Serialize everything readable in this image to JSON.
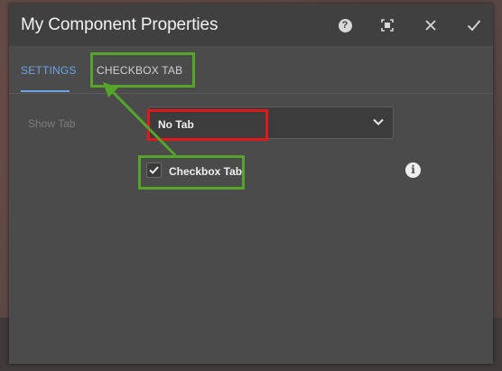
{
  "dialog": {
    "title": "My Component Properties",
    "header_icons": [
      "help-icon",
      "fullscreen-icon",
      "close-icon",
      "check-icon"
    ],
    "help_glyph": "?"
  },
  "tabs": [
    {
      "label": "SETTINGS",
      "active": true
    },
    {
      "label": "CHECKBOX TAB",
      "active": false
    }
  ],
  "form": {
    "show_tab_label": "Show Tab",
    "show_tab_value": "No Tab",
    "checkbox_label": "Checkbox Tab",
    "checkbox_checked": true,
    "info_glyph": "i"
  },
  "annotations": {
    "green": "#54a52a",
    "red": "#e0181b"
  },
  "colors": {
    "accent": "#6ea3e6",
    "dialog_bg": "#4b4b4b",
    "header_bg": "#404040"
  }
}
